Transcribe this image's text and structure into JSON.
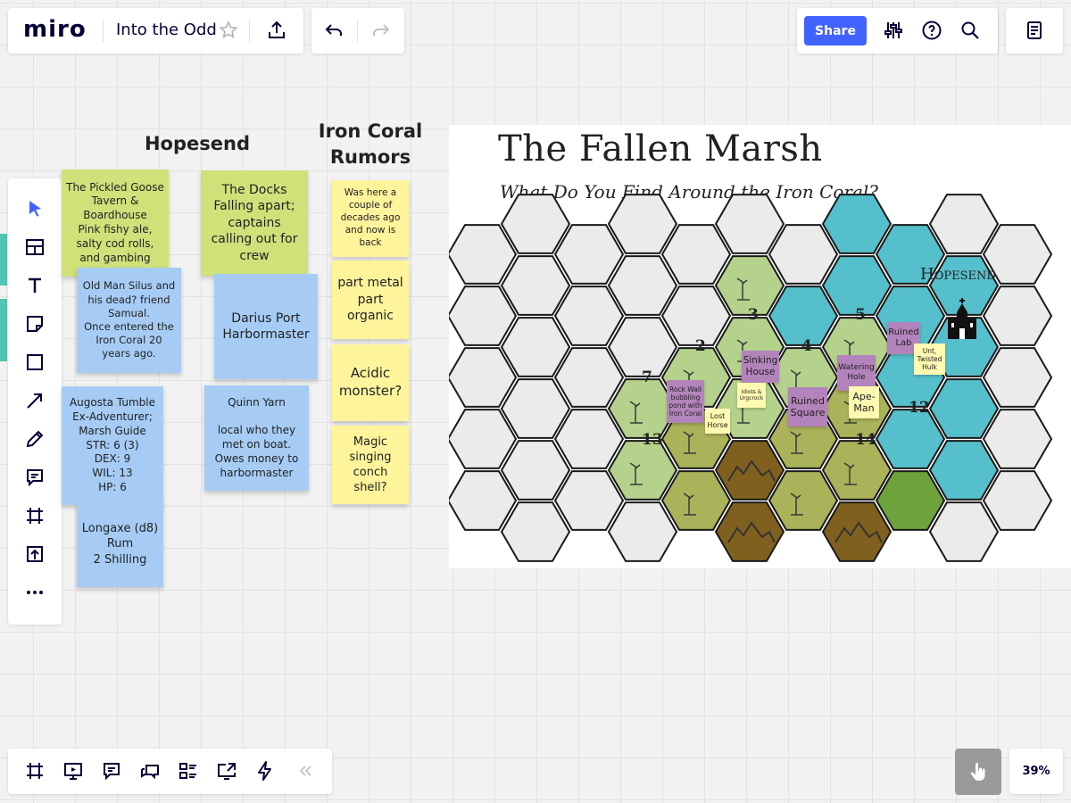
{
  "app": {
    "logo": "miro",
    "board_title": "Into the Odd",
    "share_label": "Share",
    "zoom": "39%"
  },
  "icons": {
    "topbar": [
      "star-icon",
      "export-icon",
      "undo-icon",
      "redo-icon",
      "settings-sliders-icon",
      "help-icon",
      "search-icon",
      "notes-icon"
    ],
    "left_toolbar": [
      "select-arrow-icon",
      "templates-icon",
      "text-icon",
      "sticky-note-icon",
      "shape-icon",
      "connector-arrow-icon",
      "pen-icon",
      "comment-icon",
      "frame-icon",
      "upload-icon",
      "more-icon"
    ],
    "bottom_toolbar": [
      "frames-icon",
      "presentation-icon",
      "comments-icon",
      "chat-icon",
      "cards-icon",
      "screen-share-icon",
      "lightning-icon",
      "collapse-icon"
    ],
    "corner": "hand-pointer-icon"
  },
  "headings": {
    "hopesend": "Hopesend",
    "rumors": "Iron Coral\nRumors"
  },
  "stickies": {
    "pickled_goose": "The Pickled Goose\nTavern &\nBoardhouse\nPink fishy ale,\nsalty cod rolls,\nand gambing",
    "docks": "The Docks\nFalling apart;\ncaptains\ncalling out for\ncrew",
    "old_man": "Old Man Silus and\nhis dead? friend\nSamual.\nOnce entered the\nIron Coral 20\nyears ago.",
    "darius": "Darius Port\nHarbormaster",
    "augosta": "Augosta Tumble\nEx-Adventurer;\nMarsh Guide\nSTR: 6 (3)\nDEX: 9\nWIL: 13\nHP: 6",
    "quinn": "Quinn Yarn\n\nlocal who they\nmet on boat.\nOwes money to\nharbormaster",
    "longaxe": "Longaxe (d8)\nRum\n2 Shilling",
    "rumor1": "Was here a\ncouple of\ndecades ago\nand now is\nback",
    "rumor2": "part metal\npart\norganic",
    "rumor3": "Acidic\nmonster?",
    "rumor4": "Magic\nsinging\nconch\nshell?"
  },
  "map": {
    "title": "The Fallen Marsh",
    "subtitle": "What Do You Find Around the Iron Coral?",
    "town_label": "Hopesend",
    "hex_numbers": [
      "2",
      "3",
      "4",
      "5",
      "7",
      "12",
      "13",
      "14"
    ],
    "notes": {
      "sinking_house": "Sinking\nHouse",
      "ruined_square": "Ruined\nSquare",
      "watering_hole": "Watering\nHole",
      "ruined_lab": "Ruined\nLab",
      "rock_wall": "Rock Wall\nbubbling\npond with\nIron Coral",
      "lost_horse": "Lost\nHorse",
      "idiots": "Idiots &\nUrgcrock",
      "ape_man": "Ape-\nMan",
      "unt": "Unt,\nTwisted\nHulk"
    }
  },
  "colors": {
    "accent": "#4262ff",
    "water": "#56bfcc",
    "marsh": "#b4d28c",
    "olive": "#aab25a",
    "mountain": "#80601e",
    "forest": "#6da23c",
    "empty_hex": "#ebebeb"
  },
  "map_legend": {
    "water": "water-hex",
    "marsh": "marsh-hex",
    "olive": "swamp-hex",
    "mountain": "mountain-hex",
    "forest": "forest-hex",
    "empty": "empty-hex"
  }
}
